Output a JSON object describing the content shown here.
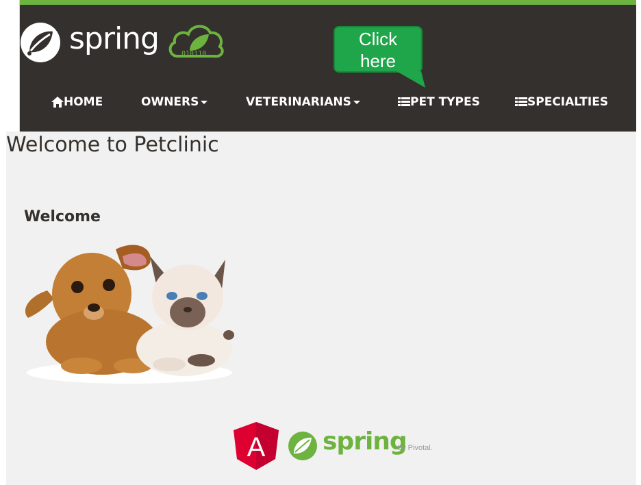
{
  "brand": {
    "logo_text": "spring",
    "cloud_binary": "010110"
  },
  "callout": {
    "line1": "Click",
    "line2": "here"
  },
  "nav": {
    "items": [
      {
        "label": "HOME",
        "icon": "home-icon"
      },
      {
        "label": "OWNERS",
        "icon": "caret-down-icon"
      },
      {
        "label": "VETERINARIANS",
        "icon": "caret-down-icon"
      },
      {
        "label": "PET TYPES",
        "icon": "list-icon"
      },
      {
        "label": "SPECIALTIES",
        "icon": "list-icon"
      }
    ]
  },
  "main": {
    "title": "Welcome to Petclinic",
    "welcome_heading": "Welcome"
  },
  "footer": {
    "angular_letter": "A",
    "spring_text": "spring",
    "pivotal_text": "by Pivotal."
  },
  "colors": {
    "navbar": "#34302d",
    "accent": "#6db33f",
    "callout": "#1fa64a",
    "background": "#f1f1f1"
  }
}
